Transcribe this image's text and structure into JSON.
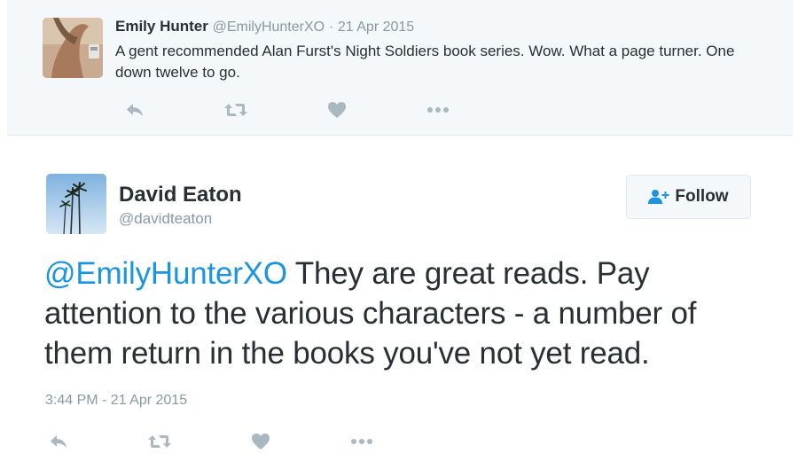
{
  "parent_tweet": {
    "name": "Emily Hunter",
    "handle": "@EmilyHunterXO",
    "separator": "·",
    "date": "21 Apr 2015",
    "text": "A gent recommended Alan Furst's Night Soldiers book series. Wow. What a page turner.  One down twelve to go.",
    "actions": [
      "reply-icon",
      "retweet-icon",
      "like-icon",
      "more-icon"
    ]
  },
  "main_tweet": {
    "name": "David Eaton",
    "handle": "@davidteaton",
    "follow_label": "Follow",
    "mention": "@EmilyHunterXO",
    "text": " They are great reads. Pay attention to the various characters - a number of them return in the books you've not yet read.",
    "timestamp": "3:44 PM - 21 Apr 2015",
    "actions": [
      "reply-icon",
      "retweet-icon",
      "like-icon",
      "more-icon"
    ]
  },
  "colors": {
    "text": "#292f33",
    "muted": "#8899a6",
    "link": "#1b95e0",
    "icon": "#aab8c2",
    "context_bg": "#f5f8fa",
    "border": "#e1e8ed"
  }
}
